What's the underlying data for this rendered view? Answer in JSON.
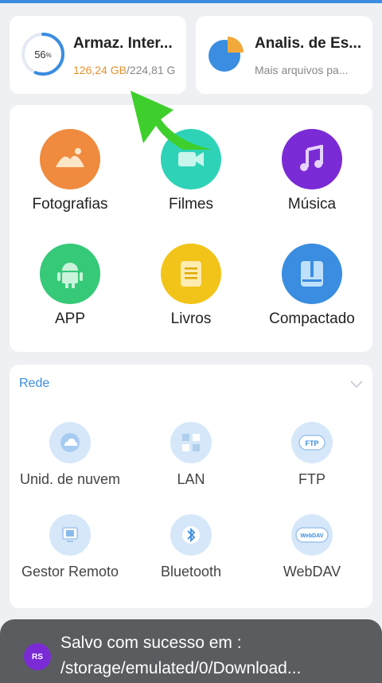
{
  "storage": {
    "percent": "56",
    "percent_sign": "%",
    "title": "Armaz. Inter...",
    "used": "126,24 GB",
    "total": "/224,81 G"
  },
  "analysis": {
    "title": "Analis. de Es...",
    "subtitle": "Mais arquivos pa..."
  },
  "categories": [
    {
      "label": "Fotografias",
      "icon": "photo-icon",
      "color": "#ef8a3e"
    },
    {
      "label": "Filmes",
      "icon": "video-icon",
      "color": "#2ed3b7"
    },
    {
      "label": "Música",
      "icon": "music-icon",
      "color": "#7a2bd6"
    },
    {
      "label": "APP",
      "icon": "android-icon",
      "color": "#35c978"
    },
    {
      "label": "Livros",
      "icon": "book-icon",
      "color": "#f2c419"
    },
    {
      "label": "Compactado",
      "icon": "archive-icon",
      "color": "#3a8de0"
    }
  ],
  "network": {
    "title": "Rede",
    "items": [
      {
        "label": "Unid. de nuvem",
        "icon": "cloud-icon"
      },
      {
        "label": "LAN",
        "icon": "lan-icon"
      },
      {
        "label": "FTP",
        "icon": "ftp-icon"
      },
      {
        "label": "Gestor Remoto",
        "icon": "remote-icon"
      },
      {
        "label": "Bluetooth",
        "icon": "bluetooth-icon"
      },
      {
        "label": "WebDAV",
        "icon": "webdav-icon"
      }
    ]
  },
  "toast": {
    "line1": "Salvo com sucesso em :",
    "line2": "/storage/emulated/0/Download...",
    "badge": "RS"
  },
  "colors": {
    "accent": "#3a8de0",
    "used": "#e8902a"
  }
}
